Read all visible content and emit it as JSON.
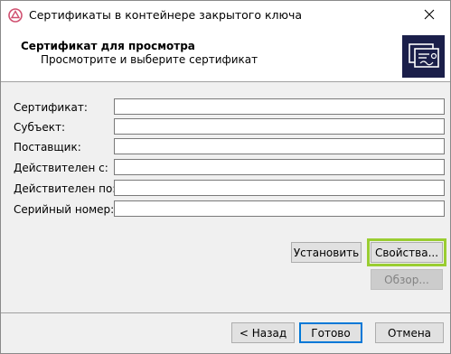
{
  "window": {
    "title": "Сертификаты в контейнере закрытого ключа"
  },
  "header": {
    "title": "Сертификат для просмотра",
    "subtitle": "Просмотрите и выберите сертификат"
  },
  "fields": [
    {
      "label": "Сертификат:",
      "value": ""
    },
    {
      "label": "Субъект:",
      "value": ""
    },
    {
      "label": "Поставщик:",
      "value": ""
    },
    {
      "label": "Действителен с:",
      "value": ""
    },
    {
      "label": "Действителен по:",
      "value": ""
    },
    {
      "label": "Серийный номер:",
      "value": ""
    }
  ],
  "buttons": {
    "install": "Установить",
    "properties": "Свойства...",
    "browse": "Обзор...",
    "back": "< Назад",
    "finish": "Готово",
    "cancel": "Отмена"
  },
  "colors": {
    "highlight": "#9acd32",
    "header_icon_bg": "#1b1f4a",
    "default_button_border": "#0078d7"
  },
  "icons": {
    "app": "cryptopro-shield-icon",
    "close": "close-icon",
    "header": "certificate-icon"
  }
}
